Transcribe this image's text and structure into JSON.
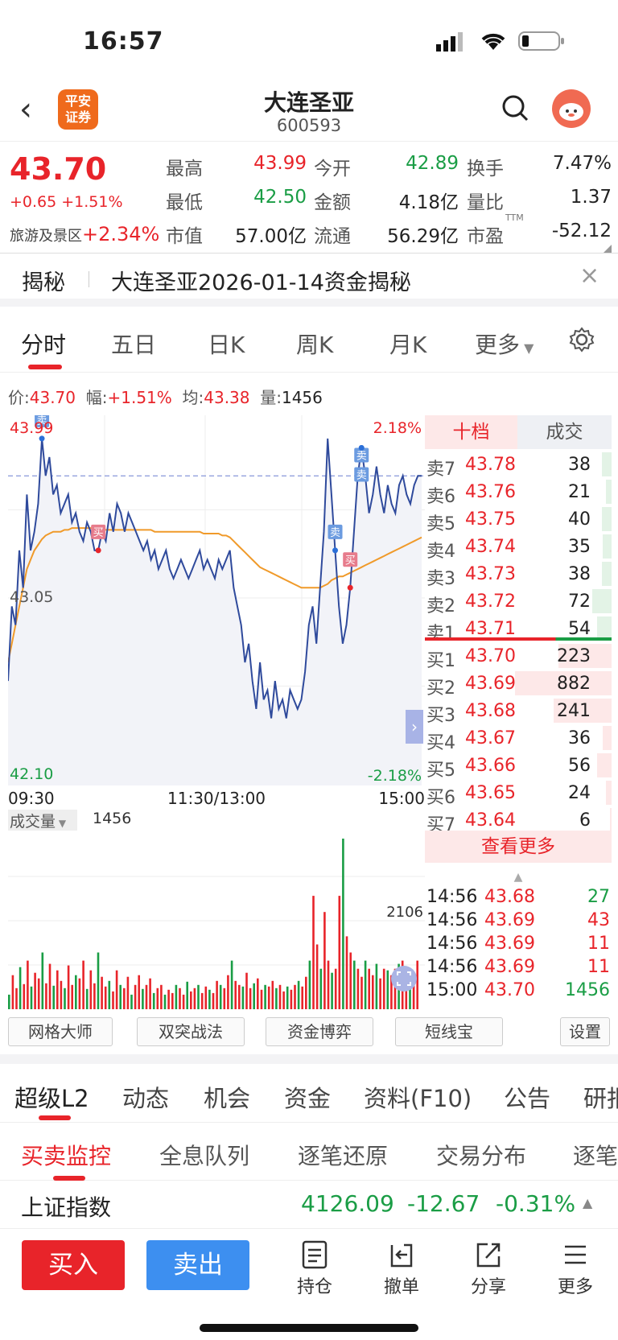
{
  "status": {
    "time": "16:57"
  },
  "header": {
    "logo_top": "平安",
    "logo_bottom": "证券",
    "name": "大连圣亚",
    "code": "600593"
  },
  "quote": {
    "price": "43.70",
    "change": "+0.65 +1.51%",
    "sector_label": "旅游及景区",
    "sector_change": "+2.34%",
    "fields": [
      {
        "label": "最高",
        "value": "43.99",
        "color": "red"
      },
      {
        "label": "今开",
        "value": "42.89",
        "color": "green"
      },
      {
        "label": "换手",
        "value": "7.47%",
        "color": "dark"
      },
      {
        "label": "最低",
        "value": "42.50",
        "color": "green"
      },
      {
        "label": "金额",
        "value": "4.18亿",
        "color": "dark"
      },
      {
        "label": "量比",
        "value": "1.37",
        "color": "dark"
      },
      {
        "label": "市值",
        "value": "57.00亿",
        "color": "dark"
      },
      {
        "label": "流通",
        "value": "56.29亿",
        "color": "dark"
      },
      {
        "label": "市盈",
        "value": "-52.12",
        "color": "dark"
      }
    ],
    "pe_suffix": "TTM"
  },
  "notice": {
    "label": "揭秘",
    "text": "大连圣亚2026-01-14资金揭秘",
    "close": "×"
  },
  "tabs": [
    "分时",
    "五日",
    "日K",
    "周K",
    "月K",
    "更多"
  ],
  "infobar": {
    "price_label": "价:",
    "price": "43.70",
    "amp_label": "幅:",
    "amp": "+1.51%",
    "avg_label": "均:",
    "avg": "43.38",
    "vol_label": "量:",
    "vol": "1456"
  },
  "chart_data": {
    "type": "line",
    "title": "",
    "y_max_label": "43.99",
    "y_mid_label": "43.05",
    "y_min_label": "42.10",
    "pct_max_label": "2.18%",
    "pct_min_label": "-2.18%",
    "ylim": [
      42.1,
      43.99
    ],
    "x_ticks": [
      "09:30",
      "11:30/13:00",
      "15:00"
    ],
    "markers": [
      {
        "label": "卖",
        "time_index": 9
      },
      {
        "label": "买",
        "time_index": 24
      },
      {
        "label": "卖",
        "time_index": 87
      },
      {
        "label": "卖",
        "time_index": 94
      },
      {
        "label": "卖",
        "time_index": 94
      },
      {
        "label": "买",
        "time_index": 91
      }
    ],
    "price_series": [
      42.6,
      43.0,
      42.9,
      43.3,
      43.1,
      43.6,
      43.3,
      43.4,
      43.55,
      43.9,
      43.7,
      43.8,
      43.6,
      43.65,
      43.5,
      43.55,
      43.6,
      43.45,
      43.5,
      43.4,
      43.35,
      43.45,
      43.4,
      43.3,
      43.3,
      43.4,
      43.35,
      43.5,
      43.4,
      43.55,
      43.5,
      43.4,
      43.5,
      43.45,
      43.4,
      43.35,
      43.3,
      43.35,
      43.25,
      43.3,
      43.2,
      43.25,
      43.3,
      43.2,
      43.15,
      43.2,
      43.25,
      43.2,
      43.15,
      43.2,
      43.25,
      43.3,
      43.2,
      43.25,
      43.2,
      43.15,
      43.25,
      43.2,
      43.25,
      43.3,
      43.1,
      43.0,
      42.9,
      42.7,
      42.8,
      42.6,
      42.45,
      42.7,
      42.5,
      42.55,
      42.4,
      42.6,
      42.45,
      42.5,
      42.4,
      42.55,
      42.5,
      42.45,
      42.5,
      42.65,
      42.9,
      43.0,
      42.8,
      43.1,
      43.4,
      43.9,
      43.6,
      43.3,
      43.0,
      42.8,
      42.9,
      43.1,
      43.4,
      43.7,
      43.85,
      43.7,
      43.5,
      43.6,
      43.75,
      43.6,
      43.5,
      43.65,
      43.55,
      43.5,
      43.65,
      43.7,
      43.6,
      43.55,
      43.65,
      43.7,
      43.7
    ],
    "avg_series": [
      42.7,
      42.8,
      42.9,
      43.0,
      43.1,
      43.2,
      43.25,
      43.3,
      43.33,
      43.36,
      43.38,
      43.39,
      43.4,
      43.4,
      43.4,
      43.41,
      43.41,
      43.42,
      43.42,
      43.42,
      43.42,
      43.42,
      43.42,
      43.41,
      43.41,
      43.41,
      43.41,
      43.41,
      43.41,
      43.41,
      43.41,
      43.41,
      43.41,
      43.41,
      43.41,
      43.41,
      43.41,
      43.41,
      43.41,
      43.4,
      43.4,
      43.4,
      43.4,
      43.4,
      43.4,
      43.4,
      43.4,
      43.4,
      43.4,
      43.4,
      43.4,
      43.4,
      43.39,
      43.39,
      43.39,
      43.39,
      43.39,
      43.38,
      43.38,
      43.37,
      43.35,
      43.33,
      43.31,
      43.29,
      43.27,
      43.25,
      43.23,
      43.21,
      43.2,
      43.19,
      43.18,
      43.17,
      43.16,
      43.15,
      43.14,
      43.13,
      43.12,
      43.11,
      43.1,
      43.1,
      43.1,
      43.1,
      43.1,
      43.1,
      43.11,
      43.12,
      43.14,
      43.15,
      43.16,
      43.16,
      43.17,
      43.18,
      43.19,
      43.2,
      43.21,
      43.22,
      43.23,
      43.24,
      43.25,
      43.26,
      43.27,
      43.28,
      43.29,
      43.3,
      43.31,
      43.32,
      43.33,
      43.34,
      43.35,
      43.36,
      43.37
    ],
    "ref_line": 43.7
  },
  "volume": {
    "label": "成交量",
    "value": "1456",
    "max_label": "2106",
    "bars": [
      180,
      420,
      260,
      520,
      310,
      600,
      280,
      450,
      380,
      700,
      320,
      560,
      290,
      480,
      350,
      260,
      540,
      300,
      420,
      380,
      600,
      250,
      480,
      320,
      700,
      400,
      280,
      350,
      220,
      480,
      300,
      260,
      400,
      180,
      300,
      420,
      250,
      300,
      380,
      200,
      260,
      300,
      180,
      240,
      200,
      300,
      260,
      180,
      340,
      220,
      260,
      300,
      200,
      280,
      240,
      200,
      350,
      300,
      260,
      420,
      600,
      350,
      300,
      280,
      450,
      260,
      320,
      380,
      240,
      300,
      280,
      350,
      260,
      300,
      220,
      280,
      240,
      300,
      350,
      280,
      400,
      600,
      1400,
      800,
      500,
      1200,
      600,
      450,
      500,
      1400,
      2106,
      900,
      700,
      600,
      500,
      400,
      600,
      500,
      420,
      560,
      380,
      500,
      480,
      420,
      500,
      560,
      600,
      500,
      460,
      420,
      600
    ],
    "bar_colors": "mixed"
  },
  "orderbook": {
    "tabs": [
      "十档",
      "成交"
    ],
    "asks": [
      {
        "label": "卖7",
        "price": "43.78",
        "qty": "38",
        "w": 0.1
      },
      {
        "label": "卖6",
        "price": "43.76",
        "qty": "21",
        "w": 0.06
      },
      {
        "label": "卖5",
        "price": "43.75",
        "qty": "40",
        "w": 0.1
      },
      {
        "label": "卖4",
        "price": "43.74",
        "qty": "35",
        "w": 0.09
      },
      {
        "label": "卖3",
        "price": "43.73",
        "qty": "38",
        "w": 0.1
      },
      {
        "label": "卖2",
        "price": "43.72",
        "qty": "72",
        "w": 0.2
      },
      {
        "label": "卖1",
        "price": "43.71",
        "qty": "54",
        "w": 0.15
      }
    ],
    "bids": [
      {
        "label": "买1",
        "price": "43.70",
        "qty": "223",
        "w": 0.55
      },
      {
        "label": "买2",
        "price": "43.69",
        "qty": "882",
        "w": 1.0
      },
      {
        "label": "买3",
        "price": "43.68",
        "qty": "241",
        "w": 0.6
      },
      {
        "label": "买4",
        "price": "43.67",
        "qty": "36",
        "w": 0.09
      },
      {
        "label": "买5",
        "price": "43.66",
        "qty": "56",
        "w": 0.15
      },
      {
        "label": "买6",
        "price": "43.65",
        "qty": "24",
        "w": 0.06
      },
      {
        "label": "买7",
        "price": "43.64",
        "qty": "6",
        "w": 0.02
      }
    ],
    "more": "查看更多",
    "trades": [
      {
        "time": "14:56",
        "price": "43.68",
        "qty": "27",
        "c": "green"
      },
      {
        "time": "14:56",
        "price": "43.69",
        "qty": "43",
        "c": "red"
      },
      {
        "time": "14:56",
        "price": "43.69",
        "qty": "11",
        "c": "red"
      },
      {
        "time": "14:56",
        "price": "43.69",
        "qty": "11",
        "c": "red"
      },
      {
        "time": "15:00",
        "price": "43.70",
        "qty": "1456",
        "c": "green"
      }
    ]
  },
  "tools": [
    "网格大师",
    "双突战法",
    "资金博弈",
    "短线宝",
    "设置"
  ],
  "subtabs": [
    "超级L2",
    "动态",
    "机会",
    "资金",
    "资料(F10)",
    "公告",
    "研报"
  ],
  "monitor_tabs": [
    "买卖监控",
    "全息队列",
    "逐笔还原",
    "交易分布",
    "逐笔"
  ],
  "index": {
    "name": "上证指数",
    "value": "4126.09",
    "change": "-12.67",
    "pct": "-0.31%"
  },
  "bottom": {
    "buy": "买入",
    "sell": "卖出",
    "items": [
      "持仓",
      "撤单",
      "分享",
      "更多"
    ]
  },
  "colors": {
    "red": "#e8242a",
    "green": "#1a9d45",
    "blue": "#2f4a9c",
    "orange": "#f09a2a",
    "sell_btn": "#3d8ff0"
  }
}
